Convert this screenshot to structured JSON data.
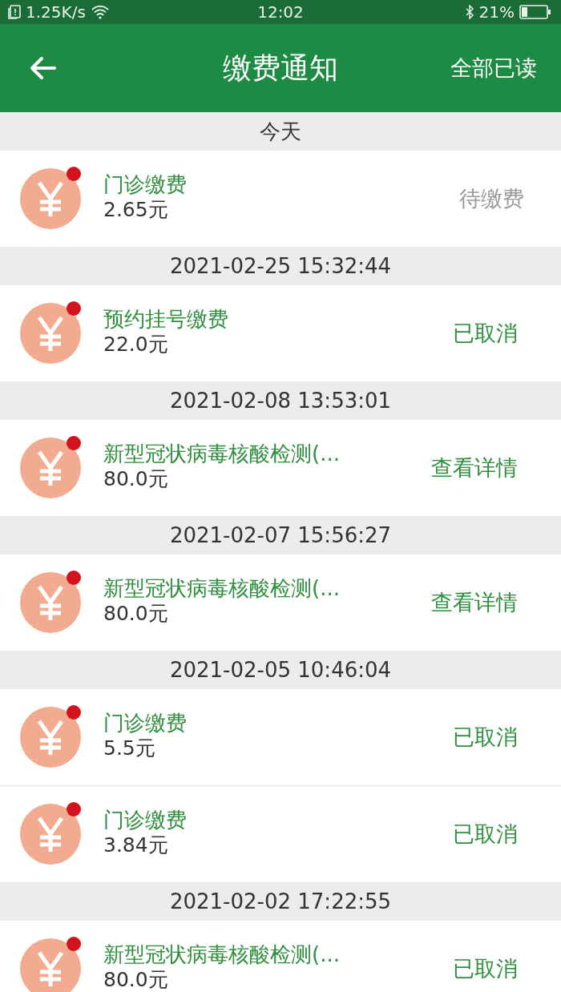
{
  "status_bar": {
    "network_speed": "1.25K/s",
    "time": "12:02",
    "battery": "21%"
  },
  "app_bar": {
    "title": "缴费通知",
    "action": "全部已读"
  },
  "groups": [
    {
      "date": "今天",
      "items": [
        {
          "title": "门诊缴费",
          "amount": "2.65元",
          "status": "待缴费",
          "kind": "pending",
          "unread": true
        }
      ]
    },
    {
      "date": "2021-02-25 15:32:44",
      "items": [
        {
          "title": "预约挂号缴费",
          "amount": "22.0元",
          "status": "已取消",
          "kind": "done",
          "unread": true
        }
      ]
    },
    {
      "date": "2021-02-08 13:53:01",
      "items": [
        {
          "title": "新型冠状病毒核酸检测(...",
          "amount": "80.0元",
          "status": "查看详情",
          "kind": "done",
          "unread": true
        }
      ]
    },
    {
      "date": "2021-02-07 15:56:27",
      "items": [
        {
          "title": "新型冠状病毒核酸检测(...",
          "amount": "80.0元",
          "status": "查看详情",
          "kind": "done",
          "unread": true
        }
      ]
    },
    {
      "date": "2021-02-05 10:46:04",
      "items": [
        {
          "title": "门诊缴费",
          "amount": "5.5元",
          "status": "已取消",
          "kind": "done",
          "unread": true
        },
        {
          "title": "门诊缴费",
          "amount": "3.84元",
          "status": "已取消",
          "kind": "done",
          "unread": true
        }
      ]
    },
    {
      "date": "2021-02-02 17:22:55",
      "items": [
        {
          "title": "新型冠状病毒核酸检测(...",
          "amount": "80.0元",
          "status": "已取消",
          "kind": "done",
          "unread": true
        }
      ]
    }
  ]
}
